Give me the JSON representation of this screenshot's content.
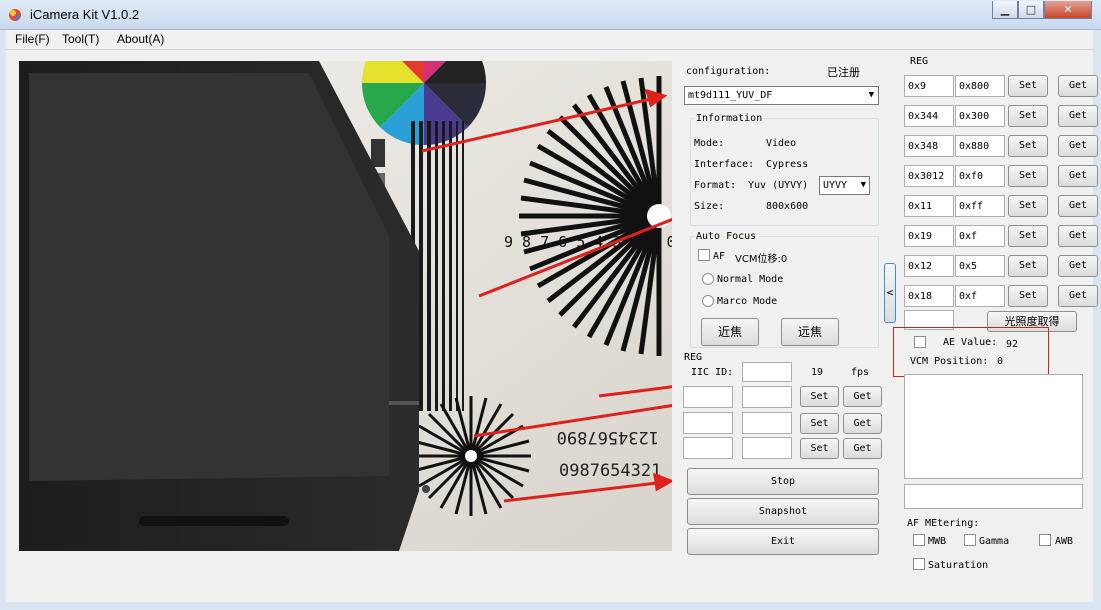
{
  "window": {
    "title": "iCamera Kit V1.0.2",
    "minimize": "▁",
    "maximize": "□",
    "close": "✕"
  },
  "menu": [
    "File(F)",
    "Tool(T)",
    "About(A)"
  ],
  "config": {
    "label": "configuration:",
    "status": "已注册",
    "selected": "mt9d111_YUV_DF",
    "info_title": "Information",
    "mode_label": "Mode:",
    "mode_value": "Video",
    "interface_label": "Interface:",
    "interface_value": "Cypress",
    "format_label": "Format:",
    "format_value": "Yuv (UYVY)",
    "format_select": "UYVY",
    "size_label": "Size:",
    "size_value": "800x600"
  },
  "autofocus": {
    "title": "Auto Focus",
    "af_label": "AF",
    "vcm_label": "VCM位移:0",
    "normal_mode": "Normal Mode",
    "marco_mode": "Marco Mode",
    "near_button": "近焦",
    "far_button": "远焦"
  },
  "reg_small": {
    "title": "REG",
    "iic_label": "IIC ID:",
    "fps_value": "19",
    "fps_label": "fps",
    "rows": [
      {
        "set": "Set",
        "get": "Get"
      },
      {
        "set": "Set",
        "get": "Get"
      },
      {
        "set": "Set",
        "get": "Get"
      }
    ]
  },
  "actions": {
    "stop": "Stop",
    "snapshot": "Snapshot",
    "exit": "Exit"
  },
  "collapse_glyph": "<",
  "reg_right": {
    "title": "REG",
    "rows": [
      {
        "addr": "0x9",
        "value": "0x800",
        "set": "Set",
        "get": "Get"
      },
      {
        "addr": "0x344",
        "value": "0x300",
        "set": "Set",
        "get": "Get"
      },
      {
        "addr": "0x348",
        "value": "0x880",
        "set": "Set",
        "get": "Get"
      },
      {
        "addr": "0x3012",
        "value": "0xf0",
        "set": "Set",
        "get": "Get"
      },
      {
        "addr": "0x11",
        "value": "0xff",
        "set": "Set",
        "get": "Get"
      },
      {
        "addr": "0x19",
        "value": "0xf",
        "set": "Set",
        "get": "Get"
      },
      {
        "addr": "0x12",
        "value": "0x5",
        "set": "Set",
        "get": "Get"
      },
      {
        "addr": "0x18",
        "value": "0xf",
        "set": "Set",
        "get": "Get"
      }
    ],
    "illum_button": "光照度取得",
    "ae_label": "AE Value:",
    "ae_value": "92",
    "vcm_label": "VCM Position:",
    "vcm_value": "0"
  },
  "metering": {
    "title": "AF MEtering:",
    "mwb": "MWB",
    "gamma": "Gamma",
    "awb": "AWB",
    "saturation": "Saturation"
  },
  "colors": {
    "arrow": "#e0201b",
    "highlight_box": "#d22020",
    "titlebar": "#c9d9ee"
  },
  "preview": {
    "dial_numbers": "9 8 7 6 5 4 3 2 1 0",
    "small_digits_1": "1234567890",
    "small_digits_2": "0987654321"
  }
}
